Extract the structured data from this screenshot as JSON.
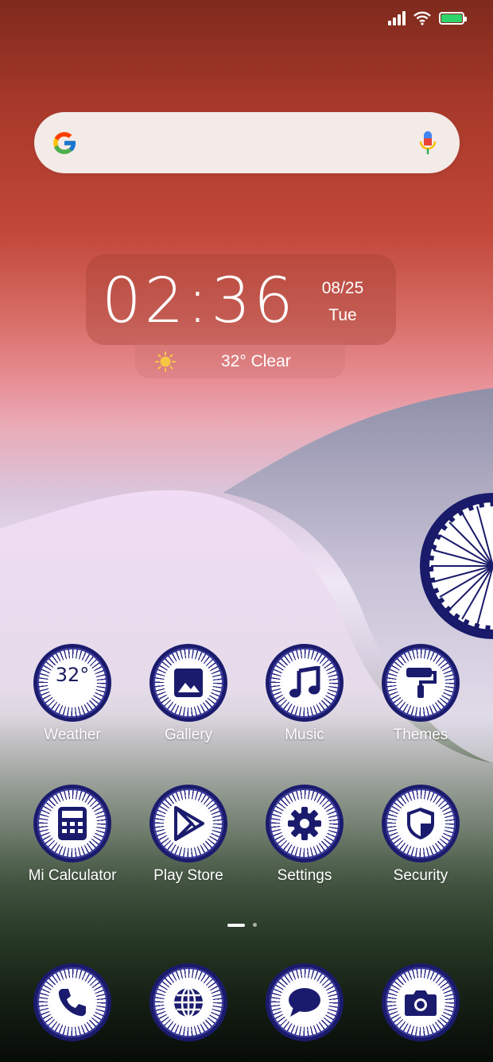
{
  "status_bar": {
    "icons": [
      "signal-icon",
      "wifi-icon",
      "battery-icon"
    ],
    "battery_color": "#2fd36b"
  },
  "search": {
    "logo": "google-g-logo",
    "mic_icon": "microphone-icon"
  },
  "clock": {
    "time": "02:36",
    "date": "08/25",
    "weekday": "Tue"
  },
  "weather_widget": {
    "icon": "sun-icon",
    "text": "32° Clear"
  },
  "apps_row1": [
    {
      "label": "Weather",
      "icon": "weather-icon",
      "value": "32°"
    },
    {
      "label": "Gallery",
      "icon": "image-icon"
    },
    {
      "label": "Music",
      "icon": "music-note-icon"
    },
    {
      "label": "Themes",
      "icon": "paint-roller-icon"
    }
  ],
  "apps_row2": [
    {
      "label": "Mi Calculator",
      "icon": "calculator-icon"
    },
    {
      "label": "Play Store",
      "icon": "play-store-icon"
    },
    {
      "label": "Settings",
      "icon": "gear-icon"
    },
    {
      "label": "Security",
      "icon": "shield-icon"
    }
  ],
  "dock": [
    {
      "icon": "phone-icon"
    },
    {
      "icon": "globe-icon"
    },
    {
      "icon": "chat-bubble-icon"
    },
    {
      "icon": "camera-icon"
    }
  ],
  "page_indicator": {
    "pages": 2,
    "current": 1
  },
  "colors": {
    "icon_navy": "#1b1b6e",
    "saffron": "#c2483a",
    "green": "#213020"
  }
}
